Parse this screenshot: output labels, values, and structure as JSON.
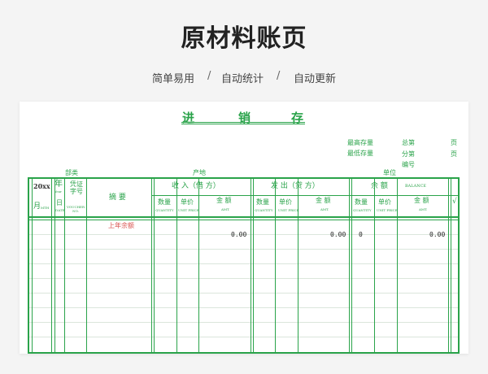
{
  "page": {
    "title": "原材料账页",
    "features": [
      "简单易用",
      "/",
      "自动统计",
      "/",
      "自动更新"
    ]
  },
  "ledger": {
    "title_chars": [
      "进",
      "销",
      "存"
    ],
    "meta": {
      "max_stock": "最高存量",
      "min_stock": "最低存量",
      "total_page": "总第",
      "sub_page": "分第",
      "page_unit": "页",
      "number": "编号",
      "department": "部类",
      "origin": "产地",
      "unit": "单位"
    },
    "headers": {
      "year": "20xx",
      "year_char": "年",
      "month": "月",
      "month_en": "MTH",
      "day": "日",
      "day_en": "DATE",
      "year_en": "Year",
      "voucher": "凭证字号",
      "voucher_en": "VOUCHER NO.",
      "summary": "摘 要",
      "income": "收 入（借 方）",
      "outgo": "发 出（贷 方）",
      "balance": "余 额",
      "balance_en": "BALANCE",
      "qty": "数量",
      "qty_en": "QUANTITY",
      "price": "单价",
      "price_en": "UNIT PRICE",
      "amount": "金 额",
      "amount_en": "AMT.",
      "check": "√"
    },
    "rows": [
      {
        "summary": "上年余额",
        "income_amt": "0.00",
        "outgo_amt": "0.00",
        "bal_qty": "0",
        "bal_amt": "0.00"
      }
    ]
  },
  "colors": {
    "accent": "#2aa34a",
    "carry_text": "#d9534f"
  }
}
